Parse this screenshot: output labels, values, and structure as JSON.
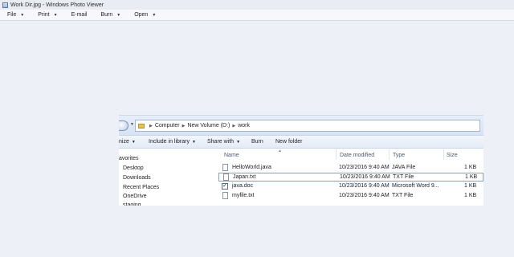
{
  "window": {
    "title": "Work Dir.jpg - Windows Photo Viewer"
  },
  "menubar": {
    "items": [
      {
        "label": "File"
      },
      {
        "label": "Print"
      },
      {
        "label": "E-mail"
      },
      {
        "label": "Burn"
      },
      {
        "label": "Open"
      }
    ]
  },
  "explorer": {
    "breadcrumb": [
      "Computer",
      "New Volume (D:)",
      "work"
    ],
    "commands": [
      {
        "label": "nize"
      },
      {
        "label": "Include in library"
      },
      {
        "label": "Share with"
      },
      {
        "label": "Burn"
      },
      {
        "label": "New folder"
      }
    ],
    "nav_items": [
      "avorites",
      "Desktop",
      "Downloads",
      "Recent Places",
      "OneDrive",
      "staging"
    ],
    "columns": [
      "Name",
      "Date modified",
      "Type",
      "Size"
    ],
    "files": [
      {
        "name": "HelloWorld.java",
        "date": "10/23/2016 9:40 AM",
        "type": "JAVA File",
        "size": "1 KB"
      },
      {
        "name": "Japan.txt",
        "date": "10/23/2016 9:40 AM",
        "type": "TXT File",
        "size": "1 KB"
      },
      {
        "name": "java.doc",
        "date": "10/23/2016 9:40 AM",
        "type": "Microsoft Word 9...",
        "size": "1 KB"
      },
      {
        "name": "myfile.txt",
        "date": "10/23/2016 9:40 AM",
        "type": "TXT File",
        "size": "1 KB"
      }
    ]
  }
}
